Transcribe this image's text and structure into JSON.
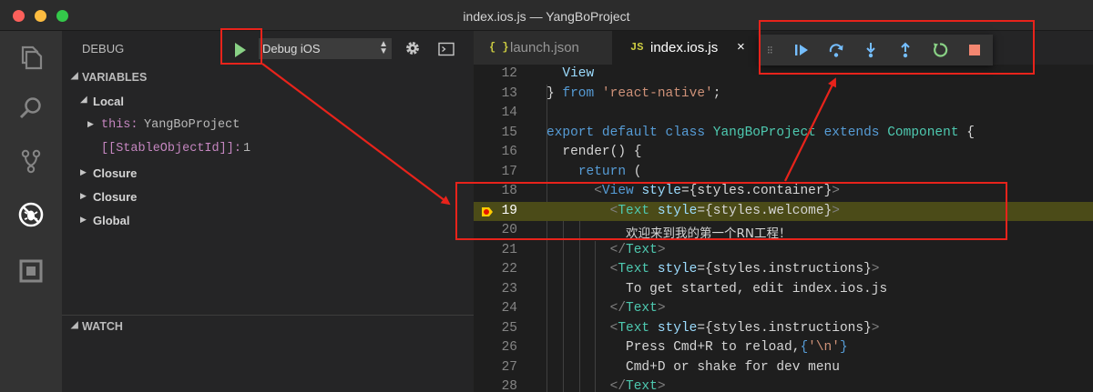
{
  "window": {
    "title": "index.ios.js — YangBoProject"
  },
  "activity_bar": [
    "explorer-icon",
    "search-icon",
    "source-control-icon",
    "debug-icon",
    "extensions-icon"
  ],
  "debug": {
    "header": "DEBUG",
    "configuration": "Debug iOS",
    "play_icon": "play-icon",
    "settings_icon": "gear-icon",
    "console_icon": "debug-console-icon"
  },
  "variables": {
    "title": "VARIABLES",
    "local_label": "Local",
    "this_name": "this:",
    "this_value": "YangBoProject",
    "stable_name": "[[StableObjectId]]:",
    "stable_value": "1",
    "closure1": "Closure",
    "closure2": "Closure",
    "global": "Global"
  },
  "watch": {
    "title": "WATCH"
  },
  "tabs": [
    {
      "icon": "{ }",
      "label": "launch.json"
    },
    {
      "icon": "JS",
      "label": "index.ios.js",
      "close": "×"
    }
  ],
  "toolbar": [
    "drag-grip-icon",
    "continue-icon",
    "step-over-icon",
    "step-into-icon",
    "step-out-icon",
    "restart-icon",
    "stop-icon"
  ],
  "colors": {
    "accent": "#89d185",
    "toolbar_blue": "#75beff",
    "stop_red": "#f48771",
    "annotation_red": "#e8231b",
    "current_line": "#4b4b18"
  },
  "code": {
    "current_line": 19,
    "lines": [
      {
        "num": "12"
      },
      {
        "num": "13"
      },
      {
        "num": "14"
      },
      {
        "num": "15"
      },
      {
        "num": "16"
      },
      {
        "num": "17"
      },
      {
        "num": "18"
      },
      {
        "num": "19"
      },
      {
        "num": "20"
      },
      {
        "num": "21"
      },
      {
        "num": "22"
      },
      {
        "num": "23"
      },
      {
        "num": "24"
      },
      {
        "num": "25"
      },
      {
        "num": "26"
      },
      {
        "num": "27"
      },
      {
        "num": "28"
      }
    ],
    "tokens": {
      "l12": "View",
      "l13a": "} ",
      "l13b": "from",
      "l13c": "'react-native'",
      "l13d": ";",
      "l15a": "export",
      "l15b": "default",
      "l15c": "class",
      "l15d": "YangBoProject",
      "l15e": "extends",
      "l15f": "Component",
      "l15g": "{",
      "l16": "render() {",
      "l17a": "return",
      "l17b": "(",
      "l18a": "<",
      "l18b": "View",
      "l18c": "style",
      "l18d": "={styles.container}",
      "l18e": ">",
      "l19a": "<",
      "l19b": "Text",
      "l19c": "style",
      "l19d": "={styles.welcome}",
      "l19e": ">",
      "l20": "欢迎来到我的第一个RN工程！",
      "l21a": "</",
      "l21b": "Text",
      "l21c": ">",
      "l22a": "<",
      "l22b": "Text",
      "l22c": "style",
      "l22d": "={styles.instructions}",
      "l22e": ">",
      "l23": "To get started, edit index.ios.js",
      "l24a": "</",
      "l24b": "Text",
      "l24c": ">",
      "l25a": "<",
      "l25b": "Text",
      "l25c": "style",
      "l25d": "={styles.instructions}",
      "l25e": ">",
      "l26a": "Press Cmd+R to reload,",
      "l26b": "{",
      "l26c": "'\\n'",
      "l26d": "}",
      "l27": "Cmd+D or shake for dev menu",
      "l28a": "</",
      "l28b": "Text",
      "l28c": ">"
    }
  }
}
